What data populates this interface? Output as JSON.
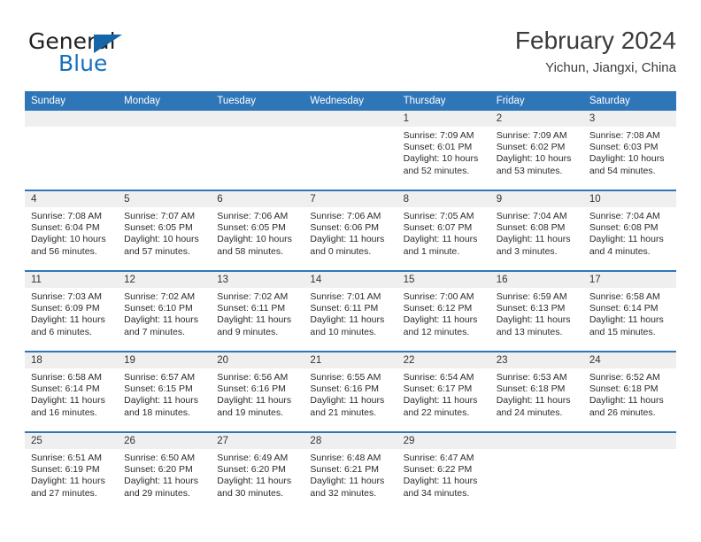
{
  "brand": {
    "name_part1": "General",
    "name_part2": "Blue",
    "triangle_color": "#1565a8",
    "blue_color": "#1570be"
  },
  "header": {
    "title": "February 2024",
    "subtitle": "Yichun, Jiangxi, China"
  },
  "theme": {
    "header_bg": "#2f76b8",
    "daynum_bg": "#efefef",
    "row_divider": "#2f76b8"
  },
  "weekdays": [
    "Sunday",
    "Monday",
    "Tuesday",
    "Wednesday",
    "Thursday",
    "Friday",
    "Saturday"
  ],
  "weeks": [
    [
      {
        "day": "",
        "sunrise": "",
        "sunset": "",
        "daylight1": "",
        "daylight2": ""
      },
      {
        "day": "",
        "sunrise": "",
        "sunset": "",
        "daylight1": "",
        "daylight2": ""
      },
      {
        "day": "",
        "sunrise": "",
        "sunset": "",
        "daylight1": "",
        "daylight2": ""
      },
      {
        "day": "",
        "sunrise": "",
        "sunset": "",
        "daylight1": "",
        "daylight2": ""
      },
      {
        "day": "1",
        "sunrise": "Sunrise: 7:09 AM",
        "sunset": "Sunset: 6:01 PM",
        "daylight1": "Daylight: 10 hours",
        "daylight2": "and 52 minutes."
      },
      {
        "day": "2",
        "sunrise": "Sunrise: 7:09 AM",
        "sunset": "Sunset: 6:02 PM",
        "daylight1": "Daylight: 10 hours",
        "daylight2": "and 53 minutes."
      },
      {
        "day": "3",
        "sunrise": "Sunrise: 7:08 AM",
        "sunset": "Sunset: 6:03 PM",
        "daylight1": "Daylight: 10 hours",
        "daylight2": "and 54 minutes."
      }
    ],
    [
      {
        "day": "4",
        "sunrise": "Sunrise: 7:08 AM",
        "sunset": "Sunset: 6:04 PM",
        "daylight1": "Daylight: 10 hours",
        "daylight2": "and 56 minutes."
      },
      {
        "day": "5",
        "sunrise": "Sunrise: 7:07 AM",
        "sunset": "Sunset: 6:05 PM",
        "daylight1": "Daylight: 10 hours",
        "daylight2": "and 57 minutes."
      },
      {
        "day": "6",
        "sunrise": "Sunrise: 7:06 AM",
        "sunset": "Sunset: 6:05 PM",
        "daylight1": "Daylight: 10 hours",
        "daylight2": "and 58 minutes."
      },
      {
        "day": "7",
        "sunrise": "Sunrise: 7:06 AM",
        "sunset": "Sunset: 6:06 PM",
        "daylight1": "Daylight: 11 hours",
        "daylight2": "and 0 minutes."
      },
      {
        "day": "8",
        "sunrise": "Sunrise: 7:05 AM",
        "sunset": "Sunset: 6:07 PM",
        "daylight1": "Daylight: 11 hours",
        "daylight2": "and 1 minute."
      },
      {
        "day": "9",
        "sunrise": "Sunrise: 7:04 AM",
        "sunset": "Sunset: 6:08 PM",
        "daylight1": "Daylight: 11 hours",
        "daylight2": "and 3 minutes."
      },
      {
        "day": "10",
        "sunrise": "Sunrise: 7:04 AM",
        "sunset": "Sunset: 6:08 PM",
        "daylight1": "Daylight: 11 hours",
        "daylight2": "and 4 minutes."
      }
    ],
    [
      {
        "day": "11",
        "sunrise": "Sunrise: 7:03 AM",
        "sunset": "Sunset: 6:09 PM",
        "daylight1": "Daylight: 11 hours",
        "daylight2": "and 6 minutes."
      },
      {
        "day": "12",
        "sunrise": "Sunrise: 7:02 AM",
        "sunset": "Sunset: 6:10 PM",
        "daylight1": "Daylight: 11 hours",
        "daylight2": "and 7 minutes."
      },
      {
        "day": "13",
        "sunrise": "Sunrise: 7:02 AM",
        "sunset": "Sunset: 6:11 PM",
        "daylight1": "Daylight: 11 hours",
        "daylight2": "and 9 minutes."
      },
      {
        "day": "14",
        "sunrise": "Sunrise: 7:01 AM",
        "sunset": "Sunset: 6:11 PM",
        "daylight1": "Daylight: 11 hours",
        "daylight2": "and 10 minutes."
      },
      {
        "day": "15",
        "sunrise": "Sunrise: 7:00 AM",
        "sunset": "Sunset: 6:12 PM",
        "daylight1": "Daylight: 11 hours",
        "daylight2": "and 12 minutes."
      },
      {
        "day": "16",
        "sunrise": "Sunrise: 6:59 AM",
        "sunset": "Sunset: 6:13 PM",
        "daylight1": "Daylight: 11 hours",
        "daylight2": "and 13 minutes."
      },
      {
        "day": "17",
        "sunrise": "Sunrise: 6:58 AM",
        "sunset": "Sunset: 6:14 PM",
        "daylight1": "Daylight: 11 hours",
        "daylight2": "and 15 minutes."
      }
    ],
    [
      {
        "day": "18",
        "sunrise": "Sunrise: 6:58 AM",
        "sunset": "Sunset: 6:14 PM",
        "daylight1": "Daylight: 11 hours",
        "daylight2": "and 16 minutes."
      },
      {
        "day": "19",
        "sunrise": "Sunrise: 6:57 AM",
        "sunset": "Sunset: 6:15 PM",
        "daylight1": "Daylight: 11 hours",
        "daylight2": "and 18 minutes."
      },
      {
        "day": "20",
        "sunrise": "Sunrise: 6:56 AM",
        "sunset": "Sunset: 6:16 PM",
        "daylight1": "Daylight: 11 hours",
        "daylight2": "and 19 minutes."
      },
      {
        "day": "21",
        "sunrise": "Sunrise: 6:55 AM",
        "sunset": "Sunset: 6:16 PM",
        "daylight1": "Daylight: 11 hours",
        "daylight2": "and 21 minutes."
      },
      {
        "day": "22",
        "sunrise": "Sunrise: 6:54 AM",
        "sunset": "Sunset: 6:17 PM",
        "daylight1": "Daylight: 11 hours",
        "daylight2": "and 22 minutes."
      },
      {
        "day": "23",
        "sunrise": "Sunrise: 6:53 AM",
        "sunset": "Sunset: 6:18 PM",
        "daylight1": "Daylight: 11 hours",
        "daylight2": "and 24 minutes."
      },
      {
        "day": "24",
        "sunrise": "Sunrise: 6:52 AM",
        "sunset": "Sunset: 6:18 PM",
        "daylight1": "Daylight: 11 hours",
        "daylight2": "and 26 minutes."
      }
    ],
    [
      {
        "day": "25",
        "sunrise": "Sunrise: 6:51 AM",
        "sunset": "Sunset: 6:19 PM",
        "daylight1": "Daylight: 11 hours",
        "daylight2": "and 27 minutes."
      },
      {
        "day": "26",
        "sunrise": "Sunrise: 6:50 AM",
        "sunset": "Sunset: 6:20 PM",
        "daylight1": "Daylight: 11 hours",
        "daylight2": "and 29 minutes."
      },
      {
        "day": "27",
        "sunrise": "Sunrise: 6:49 AM",
        "sunset": "Sunset: 6:20 PM",
        "daylight1": "Daylight: 11 hours",
        "daylight2": "and 30 minutes."
      },
      {
        "day": "28",
        "sunrise": "Sunrise: 6:48 AM",
        "sunset": "Sunset: 6:21 PM",
        "daylight1": "Daylight: 11 hours",
        "daylight2": "and 32 minutes."
      },
      {
        "day": "29",
        "sunrise": "Sunrise: 6:47 AM",
        "sunset": "Sunset: 6:22 PM",
        "daylight1": "Daylight: 11 hours",
        "daylight2": "and 34 minutes."
      },
      {
        "day": "",
        "sunrise": "",
        "sunset": "",
        "daylight1": "",
        "daylight2": ""
      },
      {
        "day": "",
        "sunrise": "",
        "sunset": "",
        "daylight1": "",
        "daylight2": ""
      }
    ]
  ]
}
